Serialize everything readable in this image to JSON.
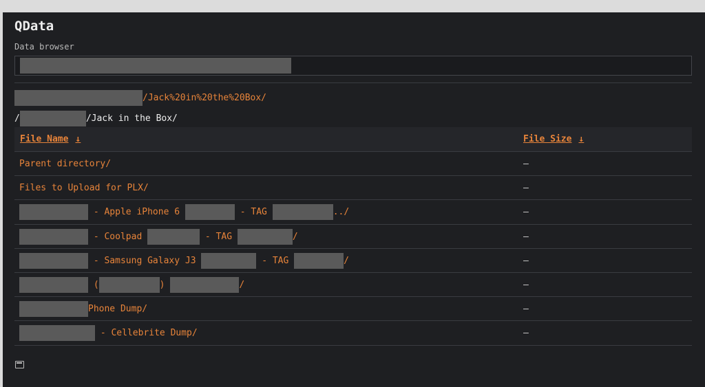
{
  "header": {
    "title": "QData",
    "subtitle": "Data browser"
  },
  "breadcrumb": {
    "url_path": "/Jack%20in%20the%20Box/",
    "display_path_prefix": "/",
    "display_path": "/Jack in the Box/"
  },
  "table": {
    "columns": {
      "name": "File Name",
      "name_sort_icon": "↓",
      "size": "File Size",
      "size_sort_icon": "↓"
    },
    "rows": [
      {
        "parts": [
          "Parent directory/"
        ],
        "size": "–"
      },
      {
        "parts": [
          "Files to Upload for PLX/"
        ],
        "size": "–"
      },
      {
        "parts": [
          " - Apple iPhone 6 ",
          " - TAG ",
          "../"
        ],
        "size": "–"
      },
      {
        "parts": [
          " - Coolpad ",
          " - TAG ",
          "/"
        ],
        "size": "–"
      },
      {
        "parts": [
          " - Samsung Galaxy J3 ",
          " - TAG ",
          "/"
        ],
        "size": "–"
      },
      {
        "parts": [
          " (",
          ") ",
          "/"
        ],
        "size": "–"
      },
      {
        "parts": [
          "Phone Dump/"
        ],
        "size": "–"
      },
      {
        "parts": [
          " - Cellebrite Dump/"
        ],
        "size": "–"
      }
    ]
  },
  "icons": {
    "footer": "window-icon"
  },
  "colors": {
    "background": "#1e1f22",
    "accent": "#e8843a",
    "text": "#ededed",
    "redaction": "#5a5a5a"
  }
}
